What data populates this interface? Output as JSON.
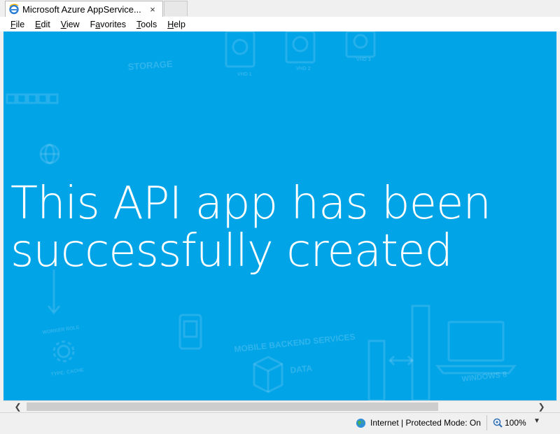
{
  "tab": {
    "title": "Microsoft Azure AppService...",
    "close_glyph": "×"
  },
  "menu": [
    "File",
    "Edit",
    "View",
    "Favorites",
    "Tools",
    "Help"
  ],
  "menu_access_keys": [
    "F",
    "E",
    "V",
    "a",
    "T",
    "H"
  ],
  "page": {
    "headline_line1": "This API app has been",
    "headline_line2": "successfully created",
    "background_color": "#02a4e8",
    "art_labels": {
      "storage": "STORAGE",
      "vhd1": "VHD 1",
      "vhd2": "VHD 2",
      "vhd3": "VHD 3",
      "worker_role": "WORKER ROLE",
      "type_cache": "TYPE: CACHE",
      "mobile_backend": "MOBILE BACKEND SERVICES",
      "data": "DATA",
      "windows8": "WINDOWS 8"
    }
  },
  "scrollbar": {
    "left_arrow": "❮",
    "right_arrow": "❯"
  },
  "status": {
    "zone_text": "Internet | Protected Mode: On",
    "zoom_text": "100%",
    "zoom_dropdown": "▼"
  }
}
